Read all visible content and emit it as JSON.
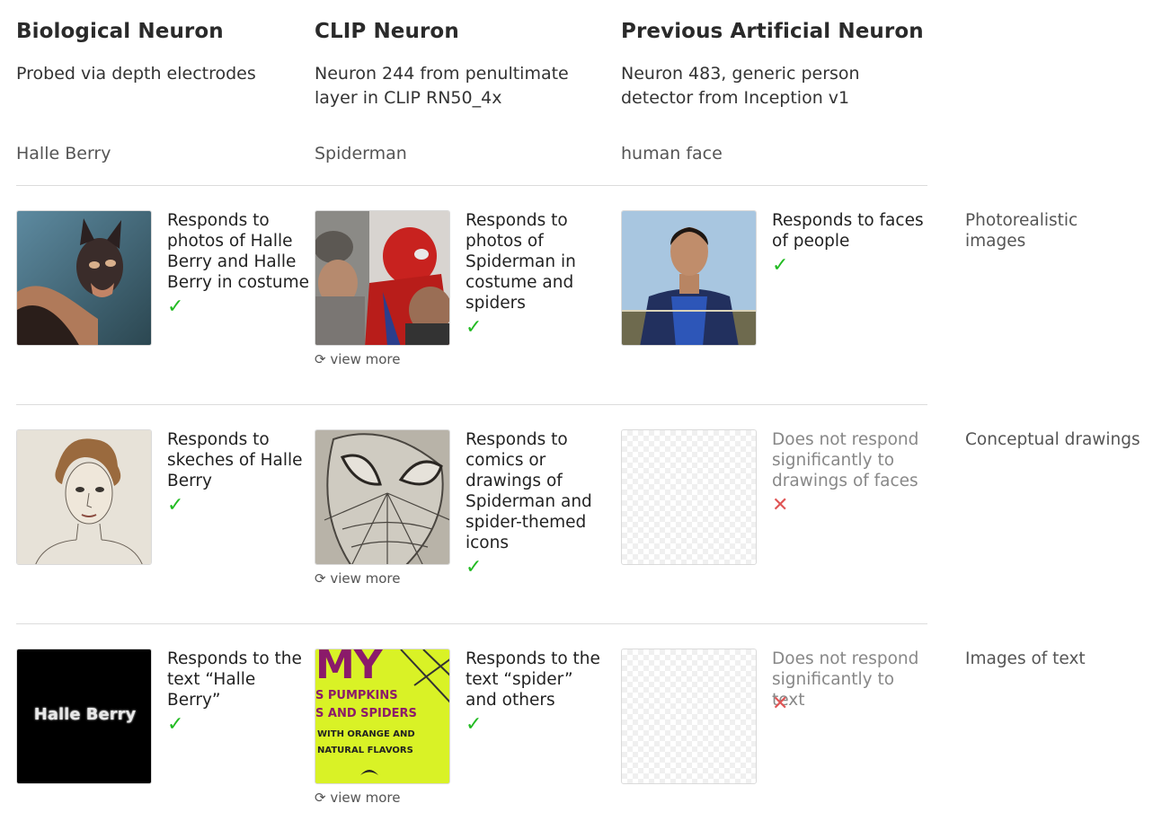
{
  "columns": [
    {
      "title": "Biological Neuron",
      "subtitle": "Probed via depth electrodes",
      "topic": "Halle Berry"
    },
    {
      "title": "CLIP Neuron",
      "subtitle": "Neuron 244 from penultimate layer in CLIP RN50_4x",
      "topic": "Spiderman"
    },
    {
      "title": "Previous Artificial Neuron",
      "subtitle": "Neuron 483, generic person detector from Inception v1",
      "topic": "human face"
    }
  ],
  "rows": [
    {
      "label": "Photorealistic images",
      "bio": {
        "text": "Responds to photos of Halle Berry and Halle Berry in costume",
        "mark": "✓"
      },
      "clip": {
        "text": "Responds to photos of Spiderman in costume and spiders",
        "mark": "✓",
        "view_more": "⟳ view more"
      },
      "prev": {
        "text": "Responds to faces of people",
        "mark": "✓"
      }
    },
    {
      "label": "Conceptual drawings",
      "bio": {
        "text": "Responds to skeches of Halle Berry",
        "mark": "✓"
      },
      "clip": {
        "text": "Responds to comics or drawings of Spiderman and spider-themed icons",
        "mark": "✓",
        "view_more": "⟳ view more"
      },
      "prev": {
        "text": "Does not respond significantly to drawings of faces",
        "mark": "✕"
      }
    },
    {
      "label": "Images of text",
      "bio": {
        "text": "Responds to the text “Halle Berry”",
        "mark": "✓",
        "image_text": "Halle Berry"
      },
      "clip": {
        "text": "Responds to the text “spider” and others",
        "mark": "✓",
        "view_more": "⟳ view more",
        "image_text": [
          "MY",
          "S PUMPKINS",
          "S AND SPIDERS",
          "WITH ORANGE AND",
          "NATURAL FLAVORS"
        ]
      },
      "prev": {
        "text": "Does not respond significantly to text",
        "mark": "✕"
      }
    }
  ],
  "colors": {
    "check": "#22bb22",
    "cross": "#e05555",
    "divider": "#dcdcdc"
  }
}
